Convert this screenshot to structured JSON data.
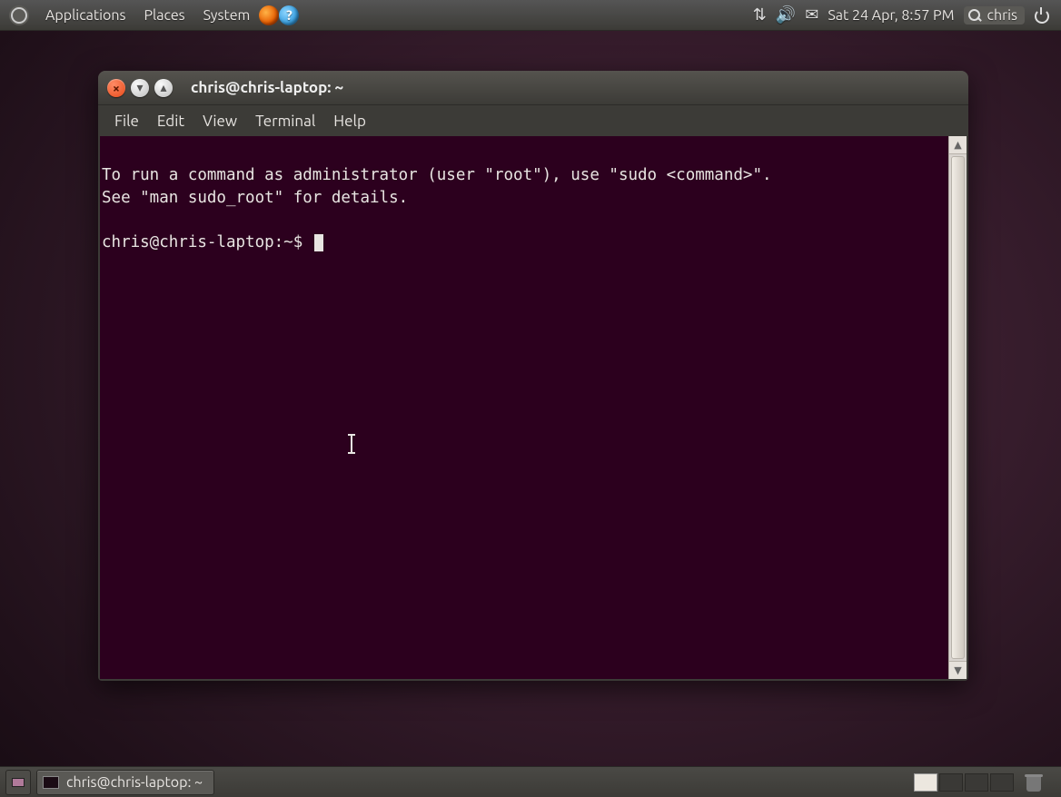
{
  "top_panel": {
    "menus": [
      "Applications",
      "Places",
      "System"
    ],
    "datetime": "Sat 24 Apr,  8:57 PM",
    "username": "chris"
  },
  "window": {
    "title": "chris@chris-laptop: ~",
    "menubar": [
      "File",
      "Edit",
      "View",
      "Terminal",
      "Help"
    ]
  },
  "terminal": {
    "motd_line1": "To run a command as administrator (user \"root\"), use \"sudo <command>\".",
    "motd_line2": "See \"man sudo_root\" for details.",
    "prompt": "chris@chris-laptop:~$ "
  },
  "taskbar": {
    "task_label": "chris@chris-laptop: ~"
  }
}
